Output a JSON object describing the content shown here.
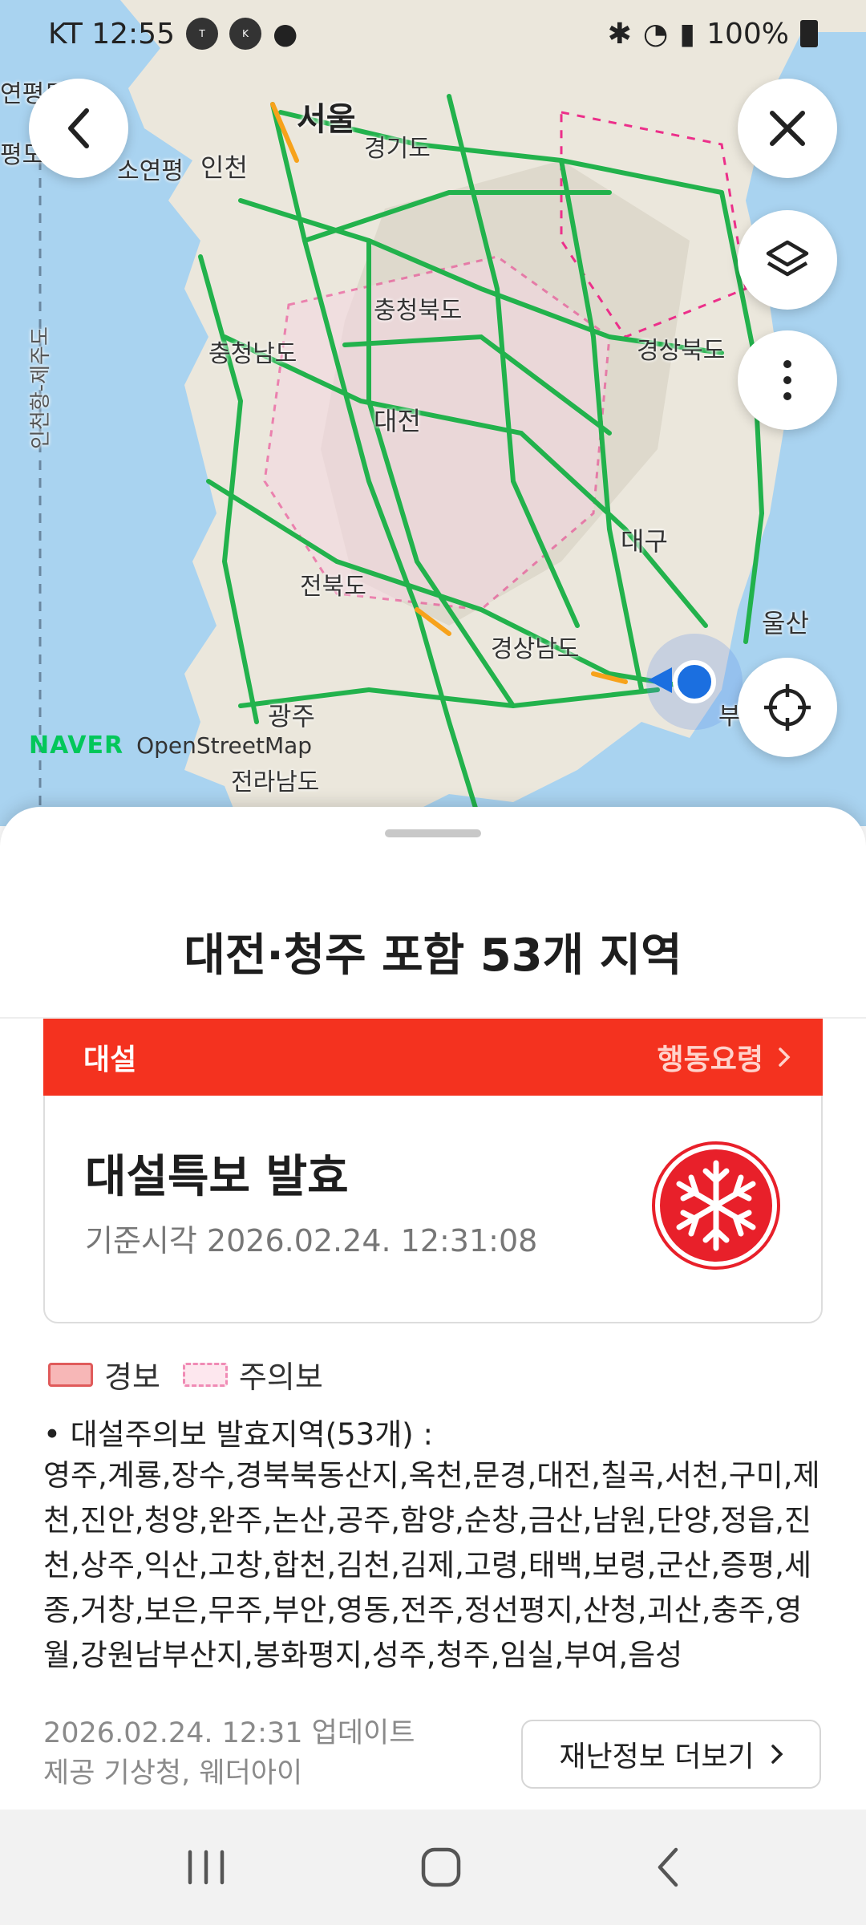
{
  "status_bar": {
    "carrier_time": "KT 12:55",
    "battery": "100%",
    "icons": [
      "talk-icon",
      "keyplus-icon",
      "dog-icon",
      "figure-icon",
      "bluetooth-icon",
      "alarm-off-icon",
      "location-icon",
      "wifi-icon",
      "lte-icon",
      "signal-icon",
      "battery-icon"
    ]
  },
  "map": {
    "labels": {
      "seoul": "서울",
      "incheon": "인천",
      "gyeonggi": "경기도",
      "soyeonpyeong": "소연평",
      "chungbuk": "충청북도",
      "chungnam": "충청남도",
      "daejeon": "대전",
      "gyeongbuk": "경상북도",
      "daegu": "대구",
      "jeonbuk": "전북도",
      "gyeongnam": "경상남도",
      "ulsan": "울산",
      "gwangju": "광주",
      "jeonnam": "전라남도",
      "busan": "부",
      "ferry": "인천항-제주도",
      "edge1": "연평도",
      "edge2": "평도"
    },
    "attribution": {
      "naver": "NAVER",
      "osm": "OpenStreetMap"
    },
    "colors": {
      "sea": "#a9d3f0",
      "land": "#e9e6dc",
      "road": "#22b24c",
      "advisory": "#ec2f8a",
      "warning": "#f7a21b"
    }
  },
  "sheet": {
    "title": "대전·청주 포함 53개 지역",
    "card": {
      "category": "대설",
      "action": "행동요령",
      "headline": "대설특보 발효",
      "time": "기준시각 2026.02.24. 12:31:08",
      "accent": "#f4321f"
    },
    "legend": {
      "warning": "경보",
      "advisory": "주의보"
    },
    "region_header": "• 대설주의보 발효지역(53개) :",
    "region_list": "영주,계룡,장수,경북북동산지,옥천,문경,대전,칠곡,서천,구미,제천,진안,청양,완주,논산,공주,함양,순창,금산,남원,단양,정읍,진천,상주,익산,고창,합천,김천,김제,고령,태백,보령,군산,증평,세종,거창,보은,무주,부안,영동,전주,정선평지,산청,괴산,충주,영월,강원남부산지,봉화평지,성주,청주,임실,부여,음성",
    "updated": "2026.02.24. 12:31 업데이트",
    "provider": "제공 기상청, 웨더아이",
    "more_button": "재난정보 더보기"
  }
}
